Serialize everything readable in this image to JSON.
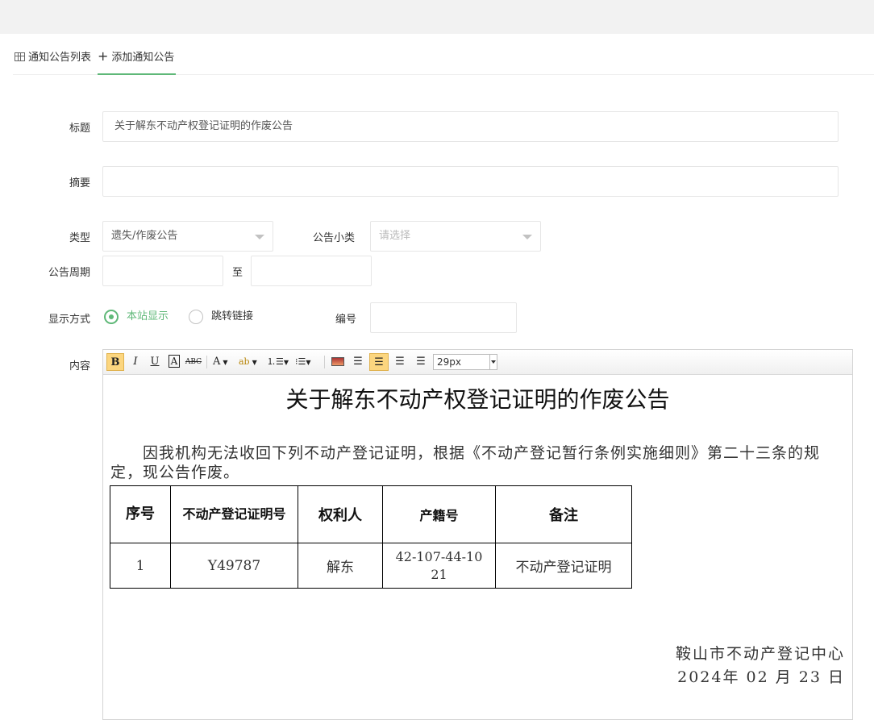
{
  "tabs": [
    {
      "label": "通知公告列表",
      "icon": "grid-icon"
    },
    {
      "label": "添加通知公告",
      "icon": "plus-icon"
    }
  ],
  "form": {
    "title_label": "标题",
    "title_value": "关于解东不动产权登记证明的作废公告",
    "summary_label": "摘要",
    "summary_value": "",
    "type_label": "类型",
    "type_value": "遗失/作废公告",
    "subtype_label": "公告小类",
    "subtype_placeholder": "请选择",
    "period_label": "公告周期",
    "period_to": "至",
    "display_label": "显示方式",
    "display_options": [
      "本站显示",
      "跳转链接"
    ],
    "display_selected": "本站显示",
    "number_label": "编号",
    "content_label": "内容"
  },
  "editor": {
    "toolbar": {
      "buttons": [
        "B",
        "I",
        "U",
        "A",
        "ABC",
        "A",
        "ab",
        "ordered-list",
        "bullet-list",
        "image",
        "align-left",
        "align-center",
        "align-right",
        "justify"
      ],
      "active": "align-center",
      "font_size": "29px"
    },
    "document": {
      "title": "关于解东不动产权登记证明的作废公告",
      "paragraph": "因我机构无法收回下列不动产登记证明，根据《不动产登记暂行条例实施细则》第二十三条的规定，现公告作废。",
      "table": {
        "headers": [
          "序号",
          "不动产登记证明号",
          "权利人",
          "产籍号",
          "备注"
        ],
        "rows": [
          [
            "1",
            "Y49787",
            "解东",
            "42-107-44-1021",
            "不动产登记证明"
          ]
        ]
      },
      "signature": "鞍山市不动产登记中心",
      "date": "2024年 02 月 23 日"
    }
  },
  "colors": {
    "accent": "#5fb878",
    "active_button": "#fcd67f",
    "topbar": "#f2f2f2"
  }
}
